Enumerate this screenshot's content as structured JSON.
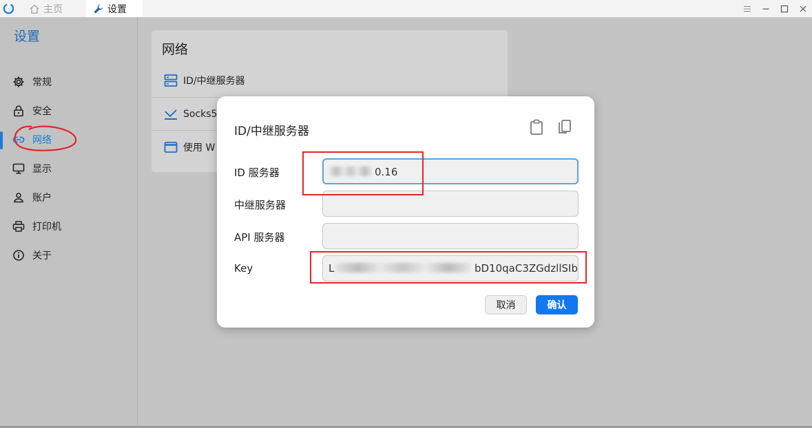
{
  "titlebar": {
    "tabs": [
      {
        "label": "主页",
        "icon": "home-icon"
      },
      {
        "label": "设置",
        "icon": "wrench-icon"
      }
    ],
    "controls": [
      "menu-icon",
      "minimize-icon",
      "maximize-icon",
      "close-icon"
    ]
  },
  "sidebar": {
    "title": "设置",
    "items": [
      {
        "label": "常规",
        "icon": "gear-icon"
      },
      {
        "label": "安全",
        "icon": "lock-icon"
      },
      {
        "label": "网络",
        "icon": "link-icon",
        "active": true
      },
      {
        "label": "显示",
        "icon": "monitor-icon"
      },
      {
        "label": "账户",
        "icon": "user-icon"
      },
      {
        "label": "打印机",
        "icon": "printer-icon"
      },
      {
        "label": "关于",
        "icon": "info-icon"
      }
    ]
  },
  "network_card": {
    "title": "网络",
    "rows": [
      {
        "label": "ID/中继服务器",
        "icon": "server-icon"
      },
      {
        "label": "Socks5/",
        "icon": "proxy-icon"
      },
      {
        "label": "使用 W",
        "icon": "window-icon"
      }
    ]
  },
  "dialog": {
    "title": "ID/中继服务器",
    "fields": {
      "id_server": {
        "label": "ID 服务器",
        "value_visible": "0.16"
      },
      "relay_server": {
        "label": "中继服务器",
        "value": ""
      },
      "api_server": {
        "label": "API 服务器",
        "value": ""
      },
      "key": {
        "label": "Key",
        "value_start": "L",
        "value_visible": "bD10qaC3ZGdzllSIb"
      }
    },
    "buttons": {
      "cancel": "取消",
      "confirm": "确认"
    }
  },
  "colors": {
    "accent": "#1e7ad8",
    "confirm_button": "#1178f0",
    "annotation": "#e0262b"
  }
}
